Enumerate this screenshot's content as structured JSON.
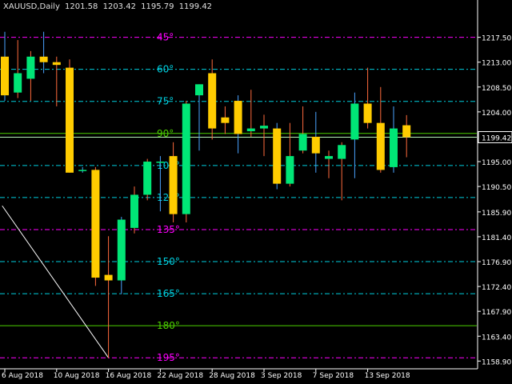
{
  "header": {
    "symbol": "XAUUSD,Daily",
    "open": "1201.58",
    "high": "1203.42",
    "low": "1195.79",
    "close": "1199.42"
  },
  "colors": {
    "background": "#000000",
    "axis": "#ffffff",
    "bull": "#00e676",
    "bear": "#ffcc00",
    "wick": "#ff6a3d",
    "wick_alt": "#4aa3ff",
    "gann_cyan": "#00d0e0",
    "gann_magenta": "#ff00ff",
    "gann_green": "#4cd000",
    "price_line": "#b8f5b8",
    "price_badge_bg": "#000000",
    "price_badge_text": "#ffffff",
    "trend_line": "#ffffff"
  },
  "chart_data": {
    "type": "candlestick",
    "y_range": [
      1157.5,
      1221.5
    ],
    "price_ticks": [
      "1217.50",
      "1213.00",
      "1208.50",
      "1204.00",
      "1199.42",
      "1195.00",
      "1190.50",
      "1185.90",
      "1181.40",
      "1176.90",
      "1172.40",
      "1167.90",
      "1163.40",
      "1158.90"
    ],
    "date_labels": [
      {
        "label": "6 Aug 2018",
        "index": 0
      },
      {
        "label": "10 Aug 2018",
        "index": 4
      },
      {
        "label": "16 Aug 2018",
        "index": 8
      },
      {
        "label": "22 Aug 2018",
        "index": 12
      },
      {
        "label": "28 Aug 2018",
        "index": 16
      },
      {
        "label": "3 Sep 2018",
        "index": 20
      },
      {
        "label": "7 Sep 2018",
        "index": 24
      },
      {
        "label": "13 Sep 2018",
        "index": 28
      }
    ],
    "candles": [
      {
        "o": 1214.0,
        "h": 1218.5,
        "l": 1206.0,
        "c": 1207.0
      },
      {
        "o": 1207.5,
        "h": 1217.0,
        "l": 1206.5,
        "c": 1211.0
      },
      {
        "o": 1210.0,
        "h": 1215.0,
        "l": 1206.0,
        "c": 1214.0
      },
      {
        "o": 1214.0,
        "h": 1218.5,
        "l": 1211.0,
        "c": 1213.0
      },
      {
        "o": 1213.0,
        "h": 1214.0,
        "l": 1205.0,
        "c": 1212.5
      },
      {
        "o": 1212.0,
        "h": 1213.5,
        "l": 1193.0,
        "c": 1193.0
      },
      {
        "o": 1193.5,
        "h": 1194.0,
        "l": 1193.0,
        "c": 1193.5
      },
      {
        "o": 1193.5,
        "h": 1194.0,
        "l": 1172.5,
        "c": 1174.0
      },
      {
        "o": 1174.5,
        "h": 1181.5,
        "l": 1159.5,
        "c": 1173.5
      },
      {
        "o": 1173.5,
        "h": 1185.0,
        "l": 1171.0,
        "c": 1184.5
      },
      {
        "o": 1183.0,
        "h": 1190.5,
        "l": 1182.0,
        "c": 1189.0
      },
      {
        "o": 1189.0,
        "h": 1195.5,
        "l": 1188.0,
        "c": 1195.0
      },
      {
        "o": 1195.0,
        "h": 1196.0,
        "l": 1186.0,
        "c": 1195.0
      },
      {
        "o": 1196.0,
        "h": 1198.5,
        "l": 1184.0,
        "c": 1185.5
      },
      {
        "o": 1185.5,
        "h": 1206.0,
        "l": 1184.0,
        "c": 1205.5
      },
      {
        "o": 1207.0,
        "h": 1209.0,
        "l": 1197.0,
        "c": 1209.0
      },
      {
        "o": 1211.0,
        "h": 1213.5,
        "l": 1199.0,
        "c": 1201.0
      },
      {
        "o": 1203.0,
        "h": 1205.0,
        "l": 1200.0,
        "c": 1202.0
      },
      {
        "o": 1206.0,
        "h": 1207.0,
        "l": 1196.5,
        "c": 1200.0
      },
      {
        "o": 1200.5,
        "h": 1208.0,
        "l": 1199.5,
        "c": 1201.0
      },
      {
        "o": 1201.0,
        "h": 1203.5,
        "l": 1196.0,
        "c": 1201.5
      },
      {
        "o": 1201.0,
        "h": 1202.0,
        "l": 1190.0,
        "c": 1191.0
      },
      {
        "o": 1191.0,
        "h": 1202.0,
        "l": 1190.5,
        "c": 1196.0
      },
      {
        "o": 1197.0,
        "h": 1205.0,
        "l": 1196.5,
        "c": 1200.0
      },
      {
        "o": 1199.5,
        "h": 1204.0,
        "l": 1193.0,
        "c": 1196.5
      },
      {
        "o": 1195.5,
        "h": 1197.0,
        "l": 1192.0,
        "c": 1196.0
      },
      {
        "o": 1195.5,
        "h": 1198.5,
        "l": 1188.0,
        "c": 1198.0
      },
      {
        "o": 1199.0,
        "h": 1207.5,
        "l": 1192.0,
        "c": 1205.5
      },
      {
        "o": 1205.5,
        "h": 1212.0,
        "l": 1201.0,
        "c": 1202.0
      },
      {
        "o": 1202.0,
        "h": 1208.5,
        "l": 1193.0,
        "c": 1193.5
      },
      {
        "o": 1194.0,
        "h": 1205.0,
        "l": 1193.0,
        "c": 1201.0
      },
      {
        "o": 1201.58,
        "h": 1203.42,
        "l": 1195.79,
        "c": 1199.42
      }
    ],
    "gann_levels": [
      {
        "label": "45°",
        "price": 1217.5,
        "color": "gann_magenta"
      },
      {
        "label": "60°",
        "price": 1211.7,
        "color": "gann_cyan"
      },
      {
        "label": "75°",
        "price": 1205.9,
        "color": "gann_cyan"
      },
      {
        "label": "90°",
        "price": 1200.1,
        "color": "gann_green"
      },
      {
        "label": "105°",
        "price": 1194.3,
        "color": "gann_cyan"
      },
      {
        "label": "120°",
        "price": 1188.5,
        "color": "gann_cyan"
      },
      {
        "label": "135°",
        "price": 1182.7,
        "color": "gann_magenta"
      },
      {
        "label": "150°",
        "price": 1176.9,
        "color": "gann_cyan"
      },
      {
        "label": "165°",
        "price": 1171.1,
        "color": "gann_cyan"
      },
      {
        "label": "180°",
        "price": 1165.3,
        "color": "gann_green"
      },
      {
        "label": "195°",
        "price": 1159.5,
        "color": "gann_magenta"
      }
    ],
    "current_price": 1199.42,
    "trend_line": {
      "from": {
        "index": -0.2,
        "price": 1187.0
      },
      "to": {
        "index": 8,
        "price": 1159.5
      }
    }
  }
}
